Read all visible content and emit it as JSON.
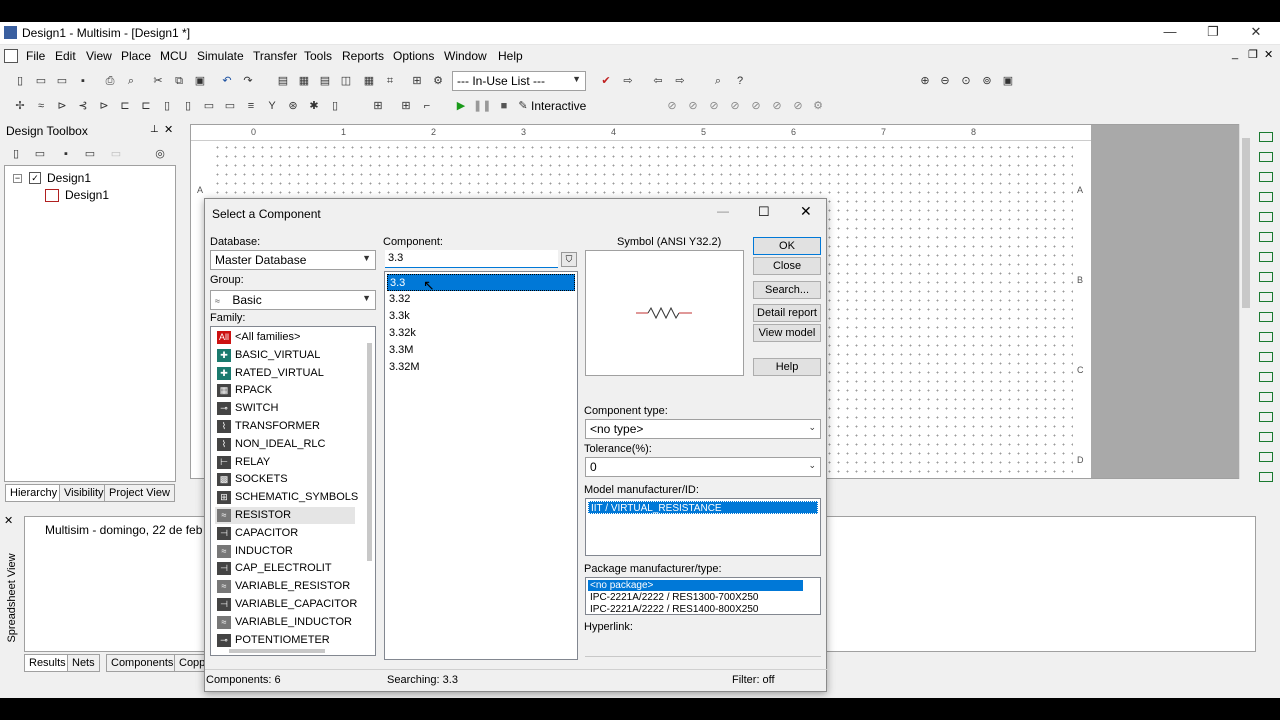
{
  "window": {
    "title": "Design1 - Multisim - [Design1 *]"
  },
  "menu": [
    "File",
    "Edit",
    "View",
    "Place",
    "MCU",
    "Simulate",
    "Transfer",
    "Tools",
    "Reports",
    "Options",
    "Window",
    "Help"
  ],
  "toolbar": {
    "inuse_list": "--- In-Use List ---",
    "interactive": "Interactive"
  },
  "design_toolbox": {
    "title": "Design Toolbox",
    "tree_root": "Design1",
    "tree_child": "Design1",
    "tabs": [
      "Hierarchy",
      "Visibility",
      "Project View"
    ]
  },
  "ruler_top": [
    "0",
    "1",
    "2",
    "3",
    "4",
    "5",
    "6",
    "7",
    "8"
  ],
  "ruler_side": [
    "A",
    "B",
    "C",
    "D"
  ],
  "spreadsheet": {
    "side_label": "Spreadsheet View",
    "message": "Multisim  -  domingo, 22 de feb",
    "tabs": [
      "Results",
      "Nets",
      "Components",
      "Copp"
    ]
  },
  "dialog": {
    "title": "Select a Component",
    "database_label": "Database:",
    "database_value": "Master Database",
    "group_label": "Group:",
    "group_value": "Basic",
    "family_label": "Family:",
    "families": [
      {
        "name": "<All families>",
        "icon": "All",
        "color": "#cc1111"
      },
      {
        "name": "BASIC_VIRTUAL",
        "icon": "✚",
        "color": "#1a7a6e"
      },
      {
        "name": "RATED_VIRTUAL",
        "icon": "✚",
        "color": "#1a7a6e"
      },
      {
        "name": "RPACK",
        "icon": "▦",
        "color": "#444444"
      },
      {
        "name": "SWITCH",
        "icon": "⊸",
        "color": "#444444"
      },
      {
        "name": "TRANSFORMER",
        "icon": "⌇",
        "color": "#444444"
      },
      {
        "name": "NON_IDEAL_RLC",
        "icon": "⌇",
        "color": "#444444"
      },
      {
        "name": "RELAY",
        "icon": "⊢",
        "color": "#444444"
      },
      {
        "name": "SOCKETS",
        "icon": "▩",
        "color": "#444444"
      },
      {
        "name": "SCHEMATIC_SYMBOLS",
        "icon": "⊞",
        "color": "#444444"
      },
      {
        "name": "RESISTOR",
        "icon": "≈",
        "color": "#777777"
      },
      {
        "name": "CAPACITOR",
        "icon": "⊣",
        "color": "#444444"
      },
      {
        "name": "INDUCTOR",
        "icon": "≈",
        "color": "#777777"
      },
      {
        "name": "CAP_ELECTROLIT",
        "icon": "⊣",
        "color": "#444444"
      },
      {
        "name": "VARIABLE_RESISTOR",
        "icon": "≈",
        "color": "#777777"
      },
      {
        "name": "VARIABLE_CAPACITOR",
        "icon": "⊣",
        "color": "#444444"
      },
      {
        "name": "VARIABLE_INDUCTOR",
        "icon": "≈",
        "color": "#777777"
      },
      {
        "name": "POTENTIOMETER",
        "icon": "⊸",
        "color": "#444444"
      }
    ],
    "component_label": "Component:",
    "component_value": "3.3",
    "components": [
      "3.3",
      "3.32",
      "3.3k",
      "3.32k",
      "3.3M",
      "3.32M"
    ],
    "symbol_label": "Symbol (ANSI Y32.2)",
    "buttons": {
      "ok": "OK",
      "close": "Close",
      "search": "Search...",
      "detail": "Detail report",
      "view_model": "View model",
      "help": "Help"
    },
    "component_type_label": "Component type:",
    "component_type_value": "<no type>",
    "tolerance_label": "Tolerance(%):",
    "tolerance_value": "0",
    "model_label": "Model manufacturer/ID:",
    "model_value": "IIT / VIRTUAL_RESISTANCE",
    "package_label": "Package manufacturer/type:",
    "packages": [
      "<no package>",
      "IPC-2221A/2222 / RES1300-700X250",
      "IPC-2221A/2222 / RES1400-800X250"
    ],
    "hyperlink_label": "Hyperlink:",
    "status": {
      "components": "Components: 6",
      "searching": "Searching: 3.3",
      "filter": "Filter: off"
    }
  }
}
